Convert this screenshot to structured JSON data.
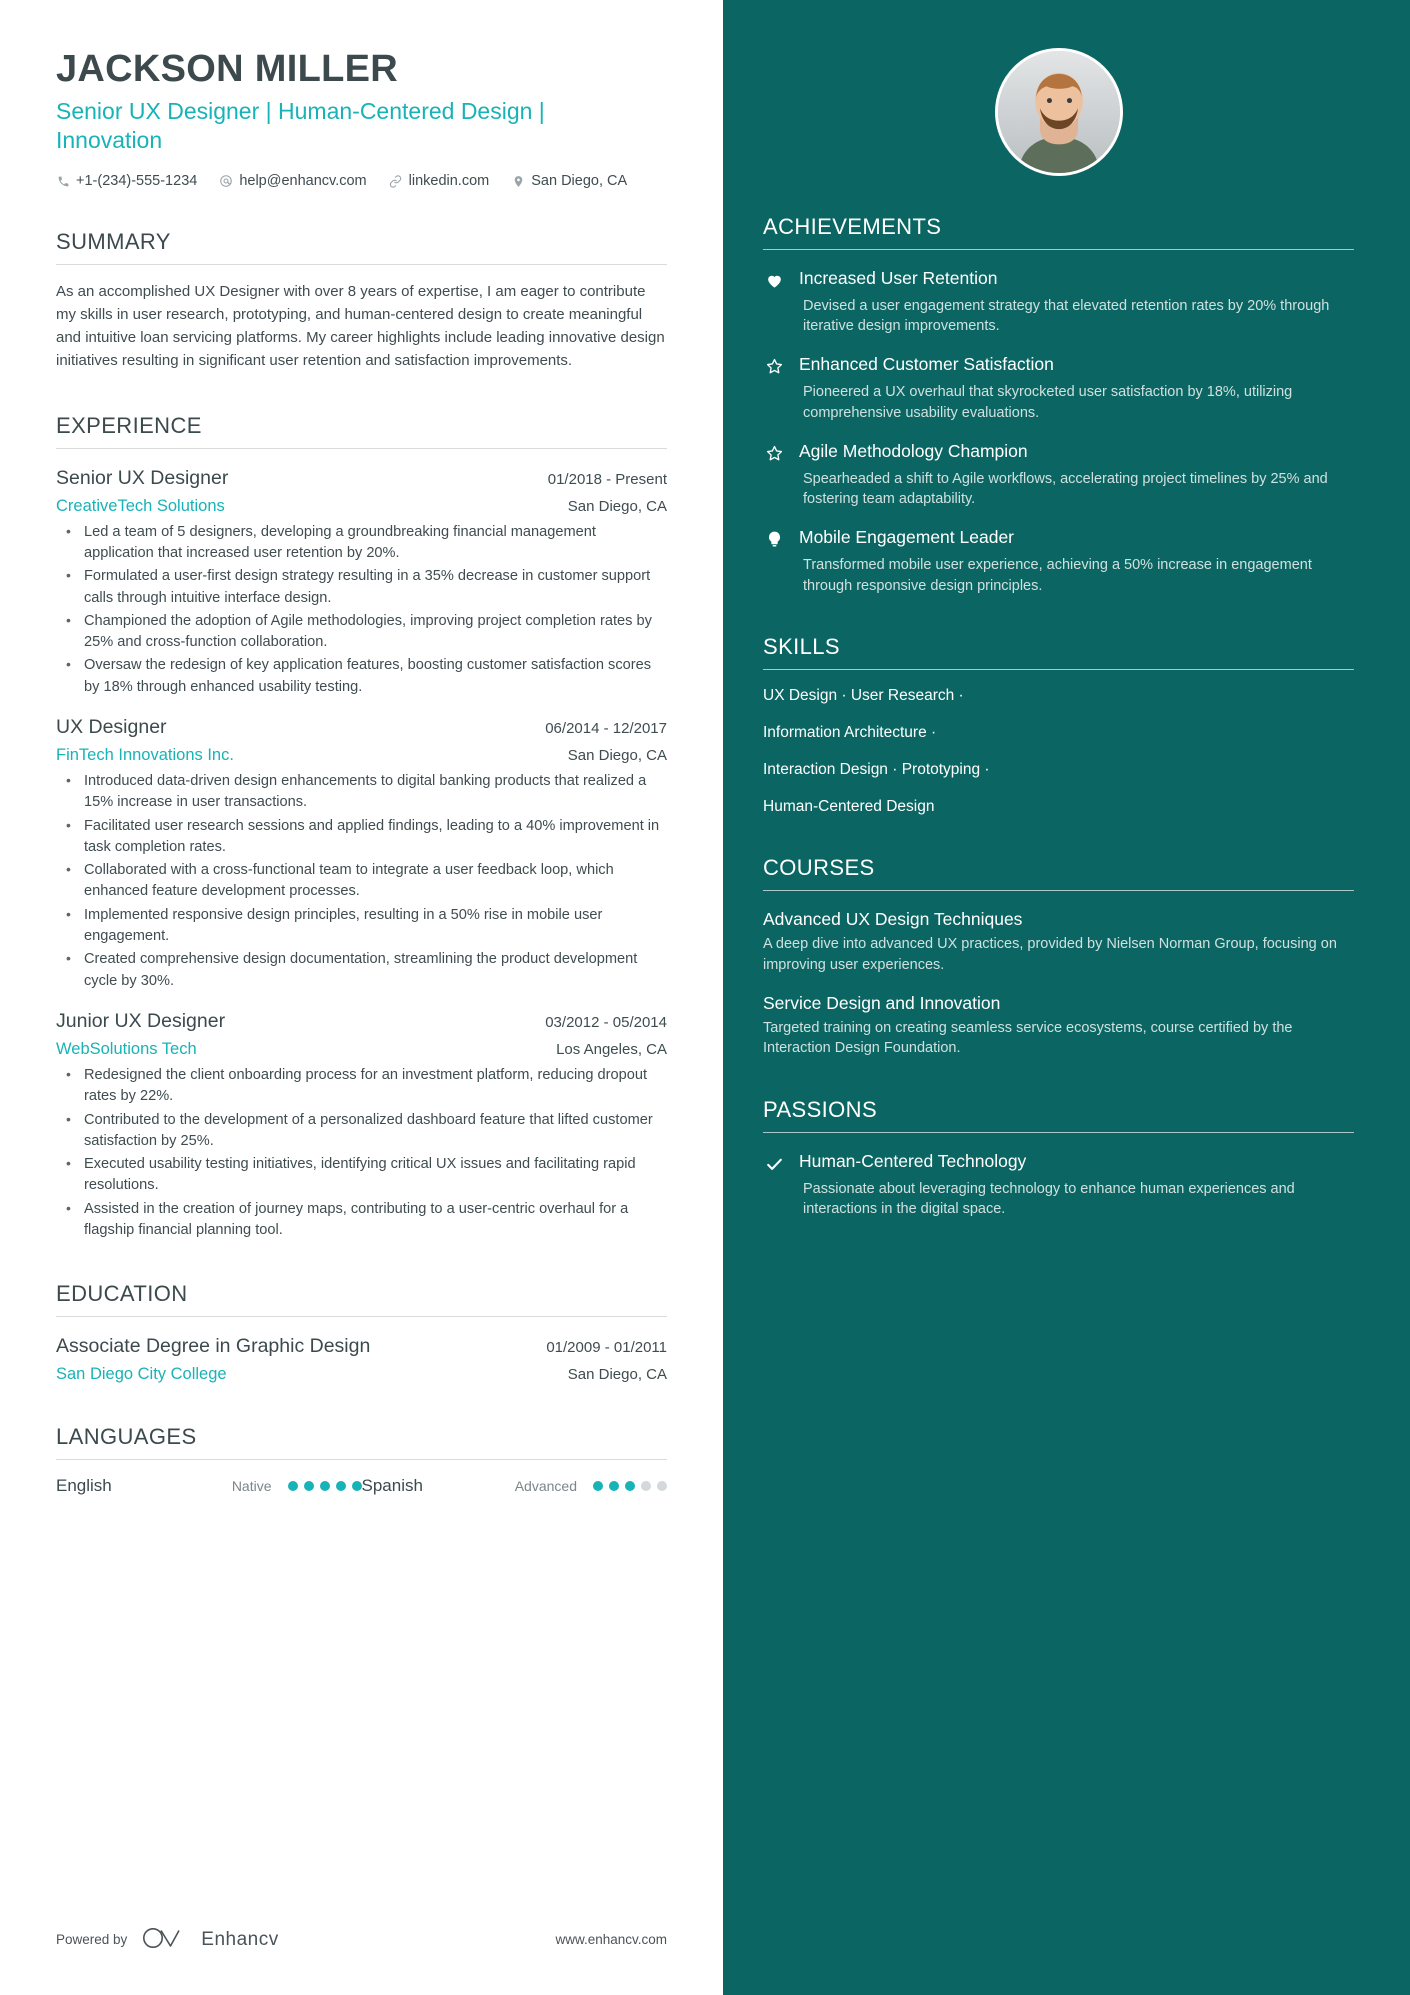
{
  "colors": {
    "accent_teal": "#18b3b7",
    "sidebar_bg": "#0b6663",
    "heading_dark": "#3c4a4e",
    "body_text": "#3f4c50",
    "sidebar_muted": "#cfe0df"
  },
  "header": {
    "name": "JACKSON MILLER",
    "headline": "Senior UX Designer | Human-Centered Design | Innovation",
    "contacts": [
      {
        "icon": "phone-icon",
        "text": "+1-(234)-555-1234"
      },
      {
        "icon": "email-icon",
        "text": "help@enhancv.com"
      },
      {
        "icon": "link-icon",
        "text": "linkedin.com"
      },
      {
        "icon": "location-pin-icon",
        "text": "San Diego, CA"
      }
    ]
  },
  "summary": {
    "title": "SUMMARY",
    "text": "As an accomplished UX Designer with over 8 years of expertise, I am eager to contribute my skills in user research, prototyping, and human-centered design to create meaningful and intuitive loan servicing platforms. My career highlights include leading innovative design initiatives resulting in significant user retention and satisfaction improvements."
  },
  "experience": {
    "title": "EXPERIENCE",
    "jobs": [
      {
        "title": "Senior UX Designer",
        "dates": "01/2018 - Present",
        "company": "CreativeTech Solutions",
        "location": "San Diego, CA",
        "bullets": [
          "Led a team of 5 designers, developing a groundbreaking financial management application that increased user retention by 20%.",
          "Formulated a user-first design strategy resulting in a 35% decrease in customer support calls through intuitive interface design.",
          "Championed the adoption of Agile methodologies, improving project completion rates by 25% and cross-function collaboration.",
          "Oversaw the redesign of key application features, boosting customer satisfaction scores by 18% through enhanced usability testing."
        ]
      },
      {
        "title": "UX Designer",
        "dates": "06/2014 - 12/2017",
        "company": "FinTech Innovations Inc.",
        "location": "San Diego, CA",
        "bullets": [
          "Introduced data-driven design enhancements to digital banking products that realized a 15% increase in user transactions.",
          "Facilitated user research sessions and applied findings, leading to a 40% improvement in task completion rates.",
          "Collaborated with a cross-functional team to integrate a user feedback loop, which enhanced feature development processes.",
          "Implemented responsive design principles, resulting in a 50% rise in mobile user engagement.",
          "Created comprehensive design documentation, streamlining the product development cycle by 30%."
        ]
      },
      {
        "title": "Junior UX Designer",
        "dates": "03/2012 - 05/2014",
        "company": "WebSolutions Tech",
        "location": "Los Angeles, CA",
        "bullets": [
          "Redesigned the client onboarding process for an investment platform, reducing dropout rates by 22%.",
          "Contributed to the development of a personalized dashboard feature that lifted customer satisfaction by 25%.",
          "Executed usability testing initiatives, identifying critical UX issues and facilitating rapid resolutions.",
          "Assisted in the creation of journey maps, contributing to a user-centric overhaul for a flagship financial planning tool."
        ]
      }
    ]
  },
  "education": {
    "title": "EDUCATION",
    "entries": [
      {
        "degree": "Associate Degree in Graphic Design",
        "dates": "01/2009 - 01/2011",
        "school": "San Diego City College",
        "location": "San Diego, CA"
      }
    ]
  },
  "languages": {
    "title": "LANGUAGES",
    "items": [
      {
        "name": "English",
        "level": "Native",
        "dots_filled": 5,
        "dots_total": 5
      },
      {
        "name": "Spanish",
        "level": "Advanced",
        "dots_filled": 3,
        "dots_total": 5
      }
    ]
  },
  "footer": {
    "powered_by": "Powered by",
    "brand": "Enhancv",
    "website": "www.enhancv.com"
  },
  "sidebar": {
    "achievements": {
      "title": "ACHIEVEMENTS",
      "items": [
        {
          "icon": "heart-icon",
          "title": "Increased User Retention",
          "desc": "Devised a user engagement strategy that elevated retention rates by 20% through iterative design improvements."
        },
        {
          "icon": "star-icon",
          "title": "Enhanced Customer Satisfaction",
          "desc": "Pioneered a UX overhaul that skyrocketed user satisfaction by 18%, utilizing comprehensive usability evaluations."
        },
        {
          "icon": "star-icon",
          "title": "Agile Methodology Champion",
          "desc": "Spearheaded a shift to Agile workflows, accelerating project timelines by 25% and fostering team adaptability."
        },
        {
          "icon": "lightbulb-icon",
          "title": "Mobile Engagement Leader",
          "desc": "Transformed mobile user experience, achieving a 50% increase in engagement through responsive design principles."
        }
      ]
    },
    "skills": {
      "title": "SKILLS",
      "lines": [
        "UX Design · User Research ·",
        "Information Architecture ·",
        "Interaction Design · Prototyping ·",
        "Human-Centered Design"
      ]
    },
    "courses": {
      "title": "COURSES",
      "items": [
        {
          "title": "Advanced UX Design Techniques",
          "desc": "A deep dive into advanced UX practices, provided by Nielsen Norman Group, focusing on improving user experiences."
        },
        {
          "title": "Service Design and Innovation",
          "desc": "Targeted training on creating seamless service ecosystems, course certified by the Interaction Design Foundation."
        }
      ]
    },
    "passions": {
      "title": "PASSIONS",
      "items": [
        {
          "icon": "check-icon",
          "title": "Human-Centered Technology",
          "desc": "Passionate about leveraging technology to enhance human experiences and interactions in the digital space."
        }
      ]
    }
  }
}
